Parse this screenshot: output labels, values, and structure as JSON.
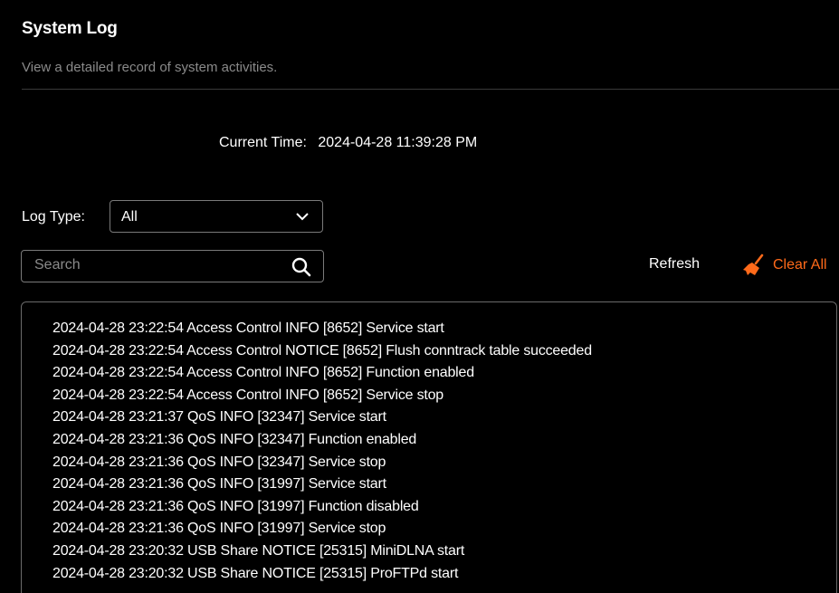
{
  "page": {
    "title": "System Log",
    "subtitle": "View a detailed record of system activities."
  },
  "current_time": {
    "label": "Current Time:",
    "value": "2024-04-28 11:39:28 PM"
  },
  "log_type": {
    "label": "Log Type:",
    "selected": "All",
    "icon": "chevron-down-icon"
  },
  "search": {
    "placeholder": "Search",
    "value": "",
    "icon": "search-icon"
  },
  "actions": {
    "refresh_label": "Refresh",
    "clear_all_label": "Clear All",
    "clear_icon": "broom-icon",
    "accent_color": "#ff6a1a"
  },
  "logs": [
    "2024-04-28 23:22:54 Access Control INFO [8652] Service start",
    "2024-04-28 23:22:54 Access Control NOTICE [8652] Flush conntrack table succeeded",
    "2024-04-28 23:22:54 Access Control INFO [8652] Function enabled",
    "2024-04-28 23:22:54 Access Control INFO [8652] Service stop",
    "2024-04-28 23:21:37 QoS INFO [32347] Service start",
    "2024-04-28 23:21:36 QoS INFO [32347] Function enabled",
    "2024-04-28 23:21:36 QoS INFO [32347] Service stop",
    "2024-04-28 23:21:36 QoS INFO [31997] Service start",
    "2024-04-28 23:21:36 QoS INFO [31997] Function disabled",
    "2024-04-28 23:21:36 QoS INFO [31997] Service stop",
    "2024-04-28 23:20:32 USB Share NOTICE [25315] MiniDLNA start",
    "2024-04-28 23:20:32 USB Share NOTICE [25315] ProFTPd start"
  ]
}
